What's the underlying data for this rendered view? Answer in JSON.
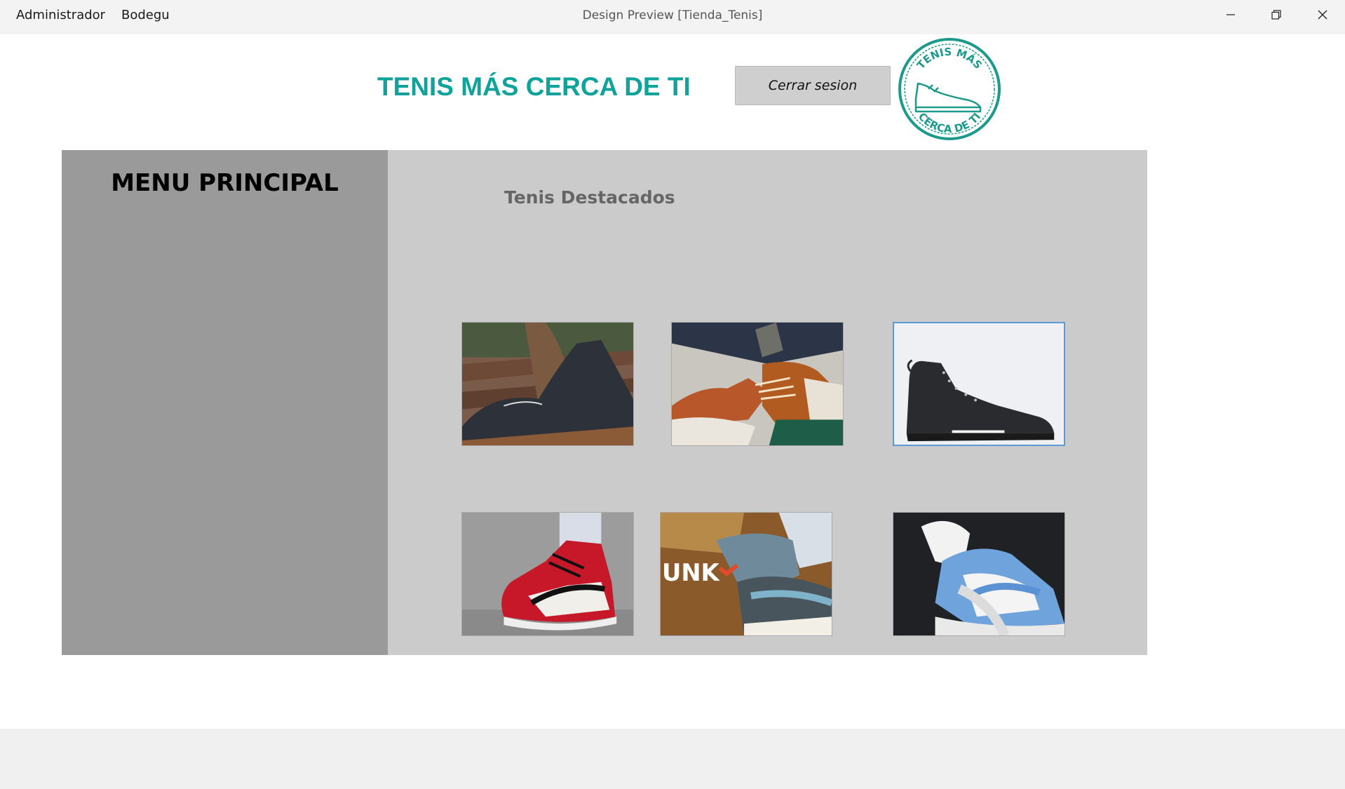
{
  "window": {
    "menu": [
      "Administrador",
      "Bodegu"
    ],
    "title": "Design Preview [Tienda_Tenis]",
    "controls": [
      "minimize-icon",
      "restore-icon",
      "close-icon"
    ]
  },
  "header": {
    "headline": "TENIS MÁS CERCA DE TI",
    "logout_label": "Cerrar sesion",
    "stamp_text_top": "TENIS MÁS",
    "stamp_text_bottom": "CERCA DE TI"
  },
  "sidebar": {
    "title": "MENU PRINCIPAL"
  },
  "main": {
    "featured_title": "Tenis Destacados",
    "products": [
      {
        "name": "dark-canvas-shoe-photo"
      },
      {
        "name": "orange-green-sneaker-photo"
      },
      {
        "name": "black-high-top-photo",
        "selected": true
      },
      {
        "name": "red-jordan-photo"
      },
      {
        "name": "nike-dunk-photo",
        "overlay_text": "UNK"
      },
      {
        "name": "blue-dunk-photo"
      }
    ]
  },
  "colors": {
    "accent": "#10a39b",
    "sidebar": "#9a9a9a",
    "panel": "#cbcbcb",
    "button": "#cfcfcf"
  }
}
